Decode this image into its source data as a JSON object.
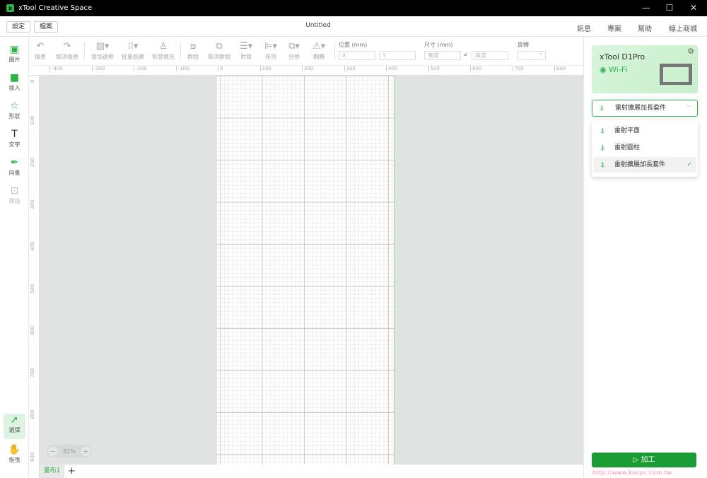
{
  "app": {
    "title": "xTool Creative Space",
    "doc_title": "Untitled"
  },
  "menu": {
    "settings": "設定",
    "file": "檔案",
    "right": [
      "訊息",
      "專案",
      "幫助",
      "線上商城"
    ]
  },
  "left_tools": [
    {
      "label": "圖片",
      "icon": "image-icon"
    },
    {
      "label": "插入",
      "icon": "insert-icon"
    },
    {
      "label": "形狀",
      "icon": "shape-icon"
    },
    {
      "label": "文字",
      "icon": "text-icon"
    },
    {
      "label": "向量",
      "icon": "pen-icon"
    },
    {
      "label": "掃描",
      "icon": "scan-icon"
    }
  ],
  "bottom_tools": [
    {
      "label": "選擇",
      "icon": "cursor-icon"
    },
    {
      "label": "拖曳",
      "icon": "hand-icon"
    }
  ],
  "toolbar": {
    "items": [
      "復原",
      "取消復原",
      "增加邊框",
      "批量創建",
      "智慧填充",
      "群組",
      "取消群組",
      "對齊",
      "排列",
      "合併",
      "翻轉"
    ],
    "position_label": "位置 (mm)",
    "x_placeholder": "X",
    "y_placeholder": "Y",
    "size_label": "尺寸 (mm)",
    "width_placeholder": "寬度",
    "height_placeholder": "高度",
    "rotate_label": "旋轉"
  },
  "ruler": {
    "top": [
      "-400",
      "-300",
      "-200",
      "-100",
      "0",
      "100",
      "200",
      "300",
      "400",
      "500",
      "600",
      "700",
      "800"
    ],
    "left": [
      "0",
      "100",
      "200",
      "300",
      "400",
      "500",
      "600",
      "700",
      "800",
      "900"
    ]
  },
  "zoom": {
    "value": "82%",
    "minus": "−",
    "plus": "+"
  },
  "tabs": {
    "active": "畫布1",
    "add": "+"
  },
  "device": {
    "name": "xTool D1Pro",
    "connection": "Wi-Fi"
  },
  "mode_select": {
    "selected": "雷射擴展加長套件",
    "options": [
      "雷射平面",
      "雷射圓柱",
      "雷射擴展加長套件"
    ]
  },
  "process_button": "加工",
  "watermark": "http://www.kocpc.com.tw",
  "colors": {
    "accent": "#2bb64a",
    "button": "#1a9b33",
    "canvas": "#e1e3e2"
  }
}
